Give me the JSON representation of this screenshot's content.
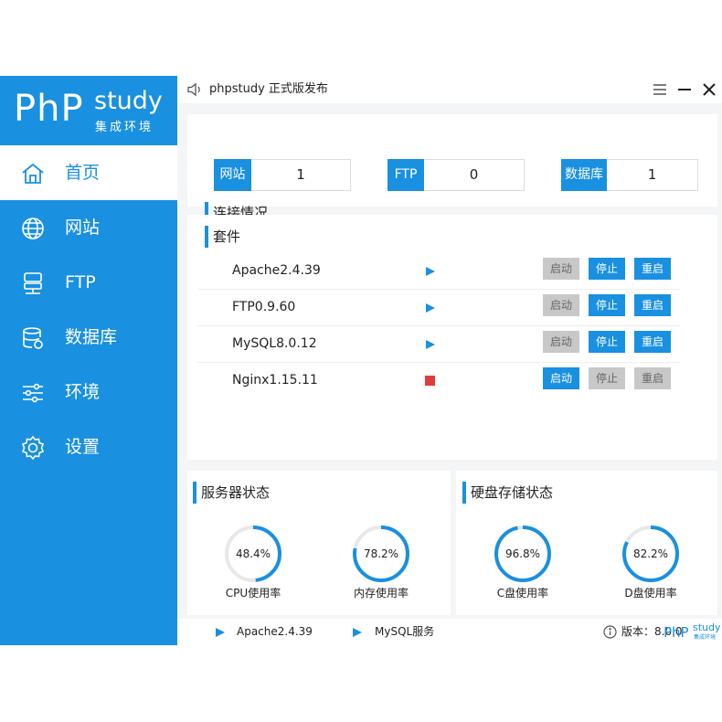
{
  "app": {
    "logo_main": "PhP",
    "logo_study": "study",
    "logo_sub": "集成环境",
    "title": "phpstudy 正式版发布",
    "accent_color": "#1a90e0"
  },
  "sidebar": {
    "items": [
      {
        "label": "首页",
        "icon": "home-icon",
        "active": true
      },
      {
        "label": "网站",
        "icon": "globe-icon"
      },
      {
        "label": "FTP",
        "icon": "server-icon"
      },
      {
        "label": "数据库",
        "icon": "database-icon"
      },
      {
        "label": "环境",
        "icon": "sliders-icon"
      },
      {
        "label": "设置",
        "icon": "gear-icon"
      }
    ]
  },
  "connections": {
    "title": "连接情况",
    "items": [
      {
        "label": "网站",
        "value": "1"
      },
      {
        "label": "FTP",
        "value": "0"
      },
      {
        "label": "数据库",
        "value": "1"
      }
    ]
  },
  "suites": {
    "title": "套件",
    "rows": [
      {
        "name": "Apache2.4.39",
        "status": "running",
        "start": "启动",
        "stop": "停止",
        "restart": "重启"
      },
      {
        "name": "FTP0.9.60",
        "status": "running",
        "start": "启动",
        "stop": "停止",
        "restart": "重启"
      },
      {
        "name": "MySQL8.0.12",
        "status": "running",
        "start": "启动",
        "stop": "停止",
        "restart": "重启"
      },
      {
        "name": "Nginx1.15.11",
        "status": "stopped",
        "start": "启动",
        "stop": "停止",
        "restart": "重启"
      }
    ]
  },
  "server_status": {
    "title": "服务器状态",
    "gauges": [
      {
        "value": "48.4%",
        "fraction": 0.484,
        "label": "CPU使用率"
      },
      {
        "value": "78.2%",
        "fraction": 0.782,
        "label": "内存使用率"
      }
    ]
  },
  "disk_status": {
    "title": "硬盘存储状态",
    "gauges": [
      {
        "value": "96.8%",
        "fraction": 0.968,
        "label": "C盘使用率"
      },
      {
        "value": "82.2%",
        "fraction": 0.822,
        "label": "D盘使用率"
      }
    ]
  },
  "statusbar": {
    "service1": "Apache2.4.39",
    "service2": "MySQL服务",
    "version": "版本：8.0.0",
    "watermark_main": "PhP",
    "watermark_study": "study",
    "watermark_sub": "集成环境"
  }
}
